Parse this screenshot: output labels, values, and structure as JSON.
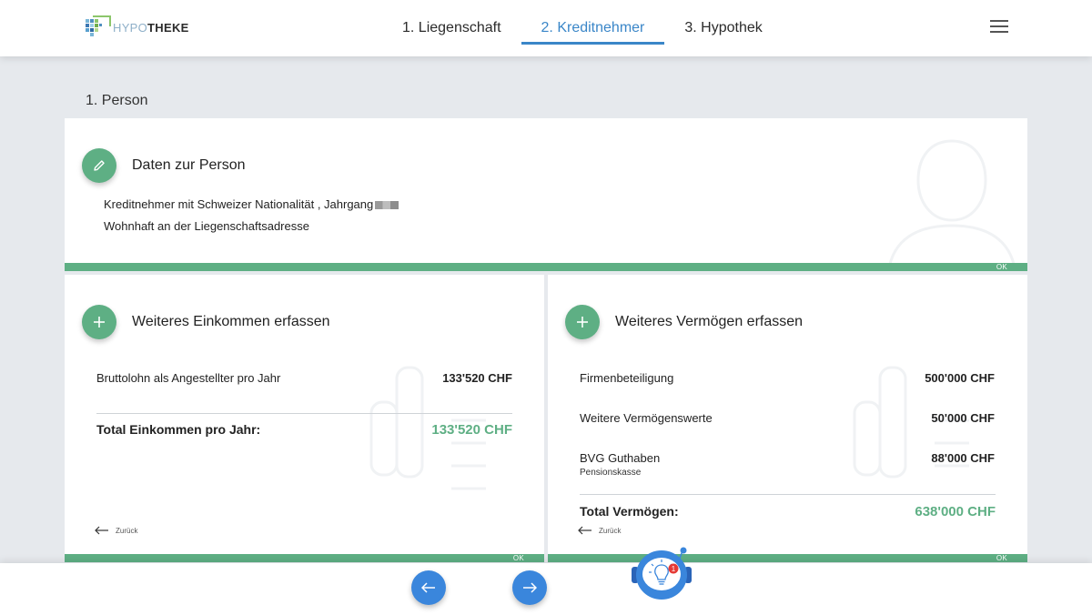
{
  "header": {
    "logo_light": "HYPO",
    "logo_bold": "THEKE",
    "tabs": [
      {
        "label": "1. Liegenschaft"
      },
      {
        "label": "2. Kreditnehmer"
      },
      {
        "label": "3. Hypothek"
      }
    ],
    "active_tab": "2. Kreditnehmer"
  },
  "section_label": "1. Person",
  "person": {
    "title": "Daten zur Person",
    "line1": "Kreditnehmer mit Schweizer Nationalität , Jahrgang",
    "line2": "Wohnhaft an der Liegenschaftsadresse",
    "ok": "OK"
  },
  "income": {
    "title": "Weiteres Einkommen erfassen",
    "rows": [
      {
        "label": "Bruttolohn als Angestellter pro Jahr",
        "value": "133'520 CHF"
      }
    ],
    "total_label": "Total Einkommen pro Jahr:",
    "total_value": "133'520 CHF",
    "back": "Zurück",
    "ok": "OK"
  },
  "assets": {
    "title": "Weiteres Vermögen erfassen",
    "rows": [
      {
        "label": "Firmenbeteiligung",
        "sub": "",
        "value": "500'000 CHF"
      },
      {
        "label": "Weitere Vermögenswerte",
        "sub": "",
        "value": "50'000 CHF"
      },
      {
        "label": "BVG Guthaben",
        "sub": "Pensionskasse",
        "value": "88'000 CHF"
      }
    ],
    "total_label": "Total Vermögen:",
    "total_value": "638'000 CHF",
    "back": "Zurück",
    "ok": "OK"
  },
  "assistant": {
    "badge": "1"
  },
  "colors": {
    "accent_green": "#5eaf84",
    "accent_blue": "#3a86c8",
    "nav_blue": "#3a86dc",
    "badge_red": "#e53935"
  }
}
